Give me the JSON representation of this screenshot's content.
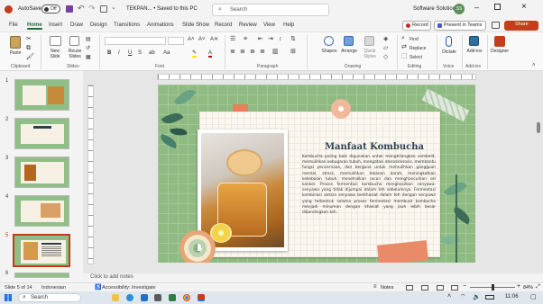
{
  "titlebar": {
    "autosave_label": "AutoSave",
    "autosave_state": "Off",
    "filename": "TEKPAN... • Saved to this PC",
    "search_placeholder": "Search",
    "account_name": "Software Solution",
    "account_initials": "SS"
  },
  "menu": {
    "items": [
      "File",
      "Home",
      "Insert",
      "Draw",
      "Design",
      "Transitions",
      "Animations",
      "Slide Show",
      "Record",
      "Review",
      "View",
      "Help"
    ],
    "active": "Home",
    "record_label": "Record",
    "present_label": "Present in Teams",
    "share_label": "Share"
  },
  "ribbon": {
    "groups": [
      "Clipboard",
      "Slides",
      "Font",
      "Paragraph",
      "Drawing",
      "Editing",
      "Voice",
      "Add-ins"
    ],
    "paste": "Paste",
    "new_slide": "New Slide",
    "reuse_slides": "Reuse Slides",
    "shapes": "Shapes",
    "arrange": "Arrange",
    "quick_styles": "Quick Styles",
    "find": "Find",
    "replace": "Replace",
    "select": "Select",
    "dictate": "Dictate",
    "addins": "Add-ins",
    "designer": "Designer"
  },
  "thumbnails": [
    {
      "num": "1"
    },
    {
      "num": "2"
    },
    {
      "num": "3"
    },
    {
      "num": "4"
    },
    {
      "num": "5"
    },
    {
      "num": "6"
    }
  ],
  "slide": {
    "title": "Manfaat Kombucha",
    "body": "Kombucha paling baik digunakan untuk menghilangkan sembelit, memulihkan kebugaran tubuh, mengatasi aterosklerosis, membantu fungsi pencernaan, dan berguna untuk memulihkan gangguan mental, stress, memulihkan tekanan darah, meningkatkan kekebalan tubuh, menetralkan racun dan menghancurkan sel kanker. Proses fermentasi kombucha menghasilkan senyawa-senyawa yang tidak dijumpai dalam teh sebelumnya. Fermentasi kombinasi antara senyawa berkhasiat dalam teh dengan senyawa yang terbentuk selama proses fermentasi membuat kombucha menjadi minuman dengan khasiat yang jauh lebih besar dibandingkan teh."
  },
  "notes": {
    "placeholder": "Click to add notes"
  },
  "status": {
    "slide_info": "Slide 5 of 14",
    "language": "Indonesian",
    "accessibility": "Accessibility: Investigate",
    "notes_label": "Notes",
    "zoom": "84%"
  },
  "taskbar": {
    "search_placeholder": "Search",
    "time": "11:06"
  }
}
